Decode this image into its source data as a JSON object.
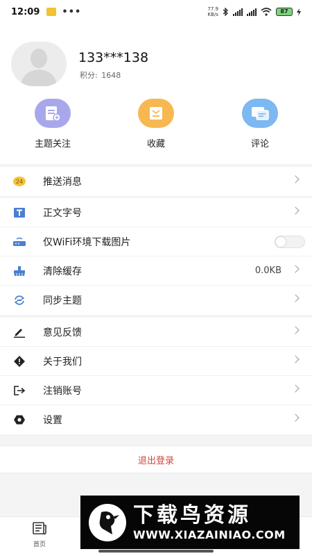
{
  "status_bar": {
    "time": "12:09",
    "dots": "•••",
    "speed_value": "77.9",
    "speed_unit": "KB/s",
    "battery": "87"
  },
  "profile": {
    "phone": "133***138",
    "points_label": "积分:",
    "points_value": "1648"
  },
  "quick_actions": [
    {
      "label": "主题关注",
      "icon": "topic-follow-icon",
      "color": "#a9a7ec"
    },
    {
      "label": "收藏",
      "icon": "favorite-icon",
      "color": "#f7b852"
    },
    {
      "label": "评论",
      "icon": "comment-icon",
      "color": "#7cb8f2"
    }
  ],
  "menu": {
    "push_messages": "推送消息",
    "push_badge": "24",
    "font_size": "正文字号",
    "wifi_only_images": "仅WiFi环境下载图片",
    "clear_cache": "清除缓存",
    "cache_size": "0.0KB",
    "sync_topics": "同步主题",
    "feedback": "意见反馈",
    "about_us": "关于我们",
    "deactivate_account": "注销账号",
    "settings": "设置"
  },
  "logout_label": "退出登录",
  "bottom_nav": {
    "home_label": "首页"
  },
  "watermark": {
    "title": "下载鸟资源",
    "url": "WWW.XIAZAINIAO.COM"
  },
  "colors": {
    "accent_red": "#d0453a",
    "icon_blue": "#4a7fd0"
  }
}
